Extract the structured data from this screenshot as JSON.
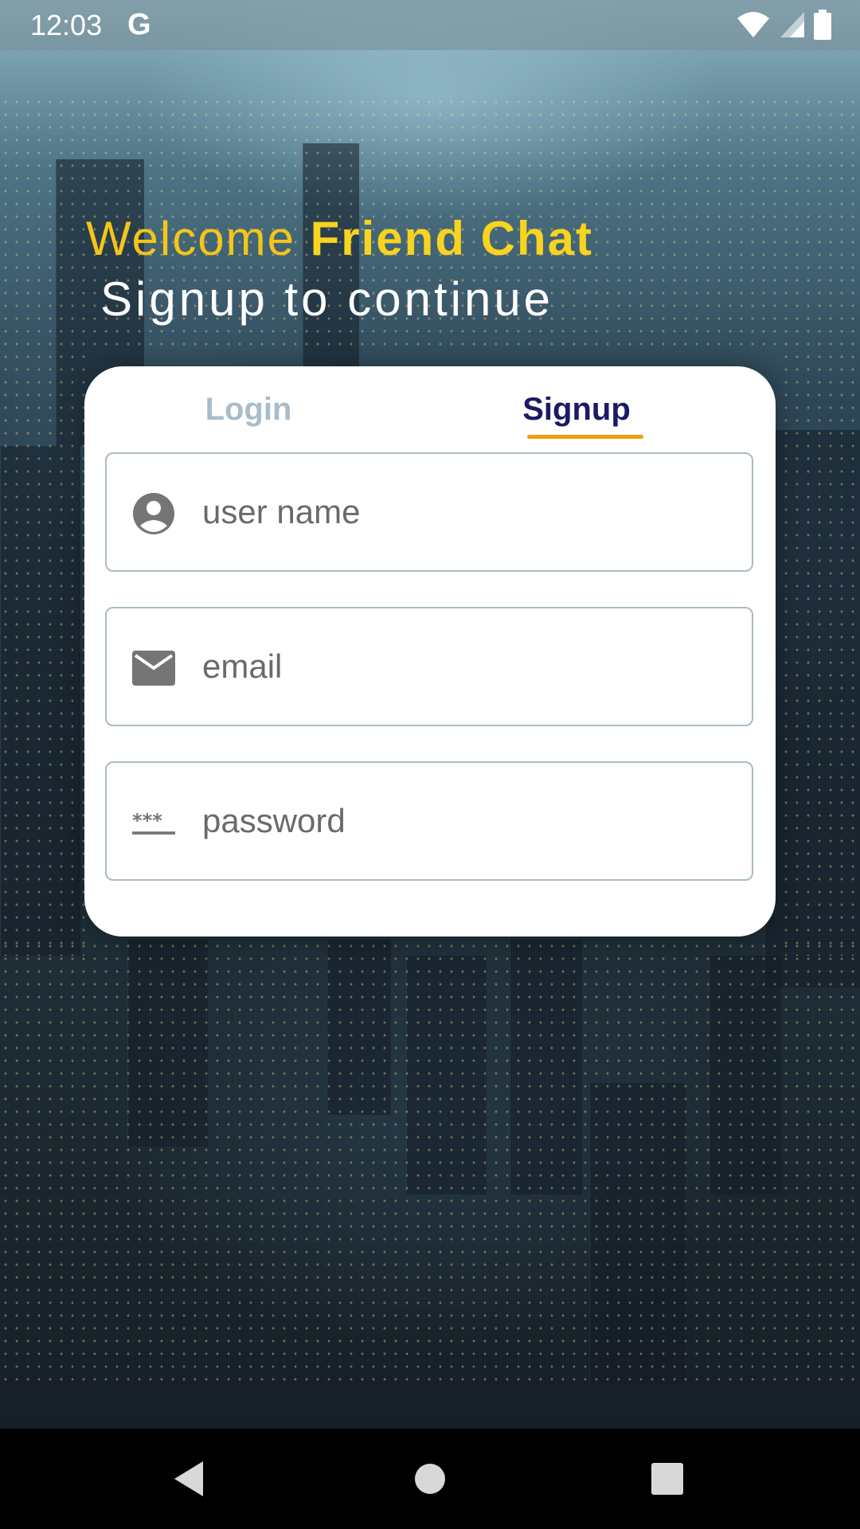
{
  "status_bar": {
    "time": "12:03",
    "google_icon": "G"
  },
  "header": {
    "welcome_prefix": "Welcome",
    "app_name": "Friend Chat",
    "subtitle": "Signup to continue"
  },
  "tabs": {
    "login_label": "Login",
    "signup_label": "Signup",
    "active": "Signup"
  },
  "form": {
    "username_placeholder": "user name",
    "email_placeholder": "email",
    "password_placeholder": "password"
  },
  "icons": {
    "username": "account-circle-icon",
    "email": "mail-icon",
    "password": "password-icon"
  },
  "colors": {
    "welcome": "#f5c518",
    "active_tab": "#1b1a63",
    "inactive_tab": "#a9bccb",
    "tab_underline": "#f39c12",
    "field_border": "#a8bcc7"
  }
}
